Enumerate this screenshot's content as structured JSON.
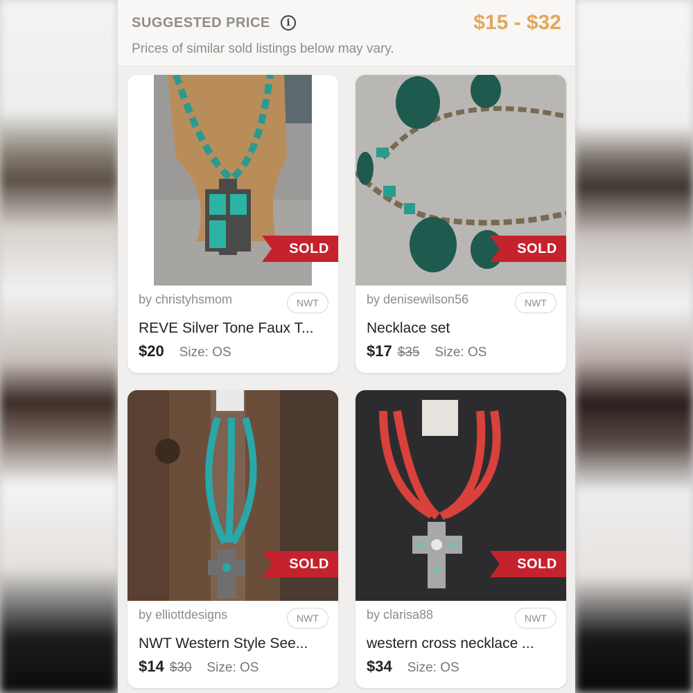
{
  "header": {
    "title": "SUGGESTED PRICE",
    "info_icon": "i",
    "price_range": "$15 - $32",
    "subtitle": "Prices of similar sold listings below may vary."
  },
  "colors": {
    "accent_price": "#e2a85a",
    "sold_ribbon": "#c4232d"
  },
  "listings": [
    {
      "seller": "by christyhsmom",
      "badge": "NWT",
      "title": "REVE Silver Tone Faux T...",
      "price": "$20",
      "original_price": "",
      "size": "Size: OS",
      "status": "SOLD",
      "image_icon": "turquoise-cross-necklace"
    },
    {
      "seller": "by denisewilson56",
      "badge": "NWT",
      "title": "Necklace set",
      "price": "$17",
      "original_price": "$35",
      "size": "Size: OS",
      "status": "SOLD",
      "image_icon": "chain-necklace-set"
    },
    {
      "seller": "by elliottdesigns",
      "badge": "NWT",
      "title": "NWT Western Style See...",
      "price": "$14",
      "original_price": "$30",
      "size": "Size: OS",
      "status": "SOLD",
      "image_icon": "seed-bead-cross-necklace"
    },
    {
      "seller": "by clarisa88",
      "badge": "NWT",
      "title": "western  cross necklace ...",
      "price": "$34",
      "original_price": "",
      "size": "Size: OS",
      "status": "SOLD",
      "image_icon": "red-cross-necklace"
    }
  ]
}
